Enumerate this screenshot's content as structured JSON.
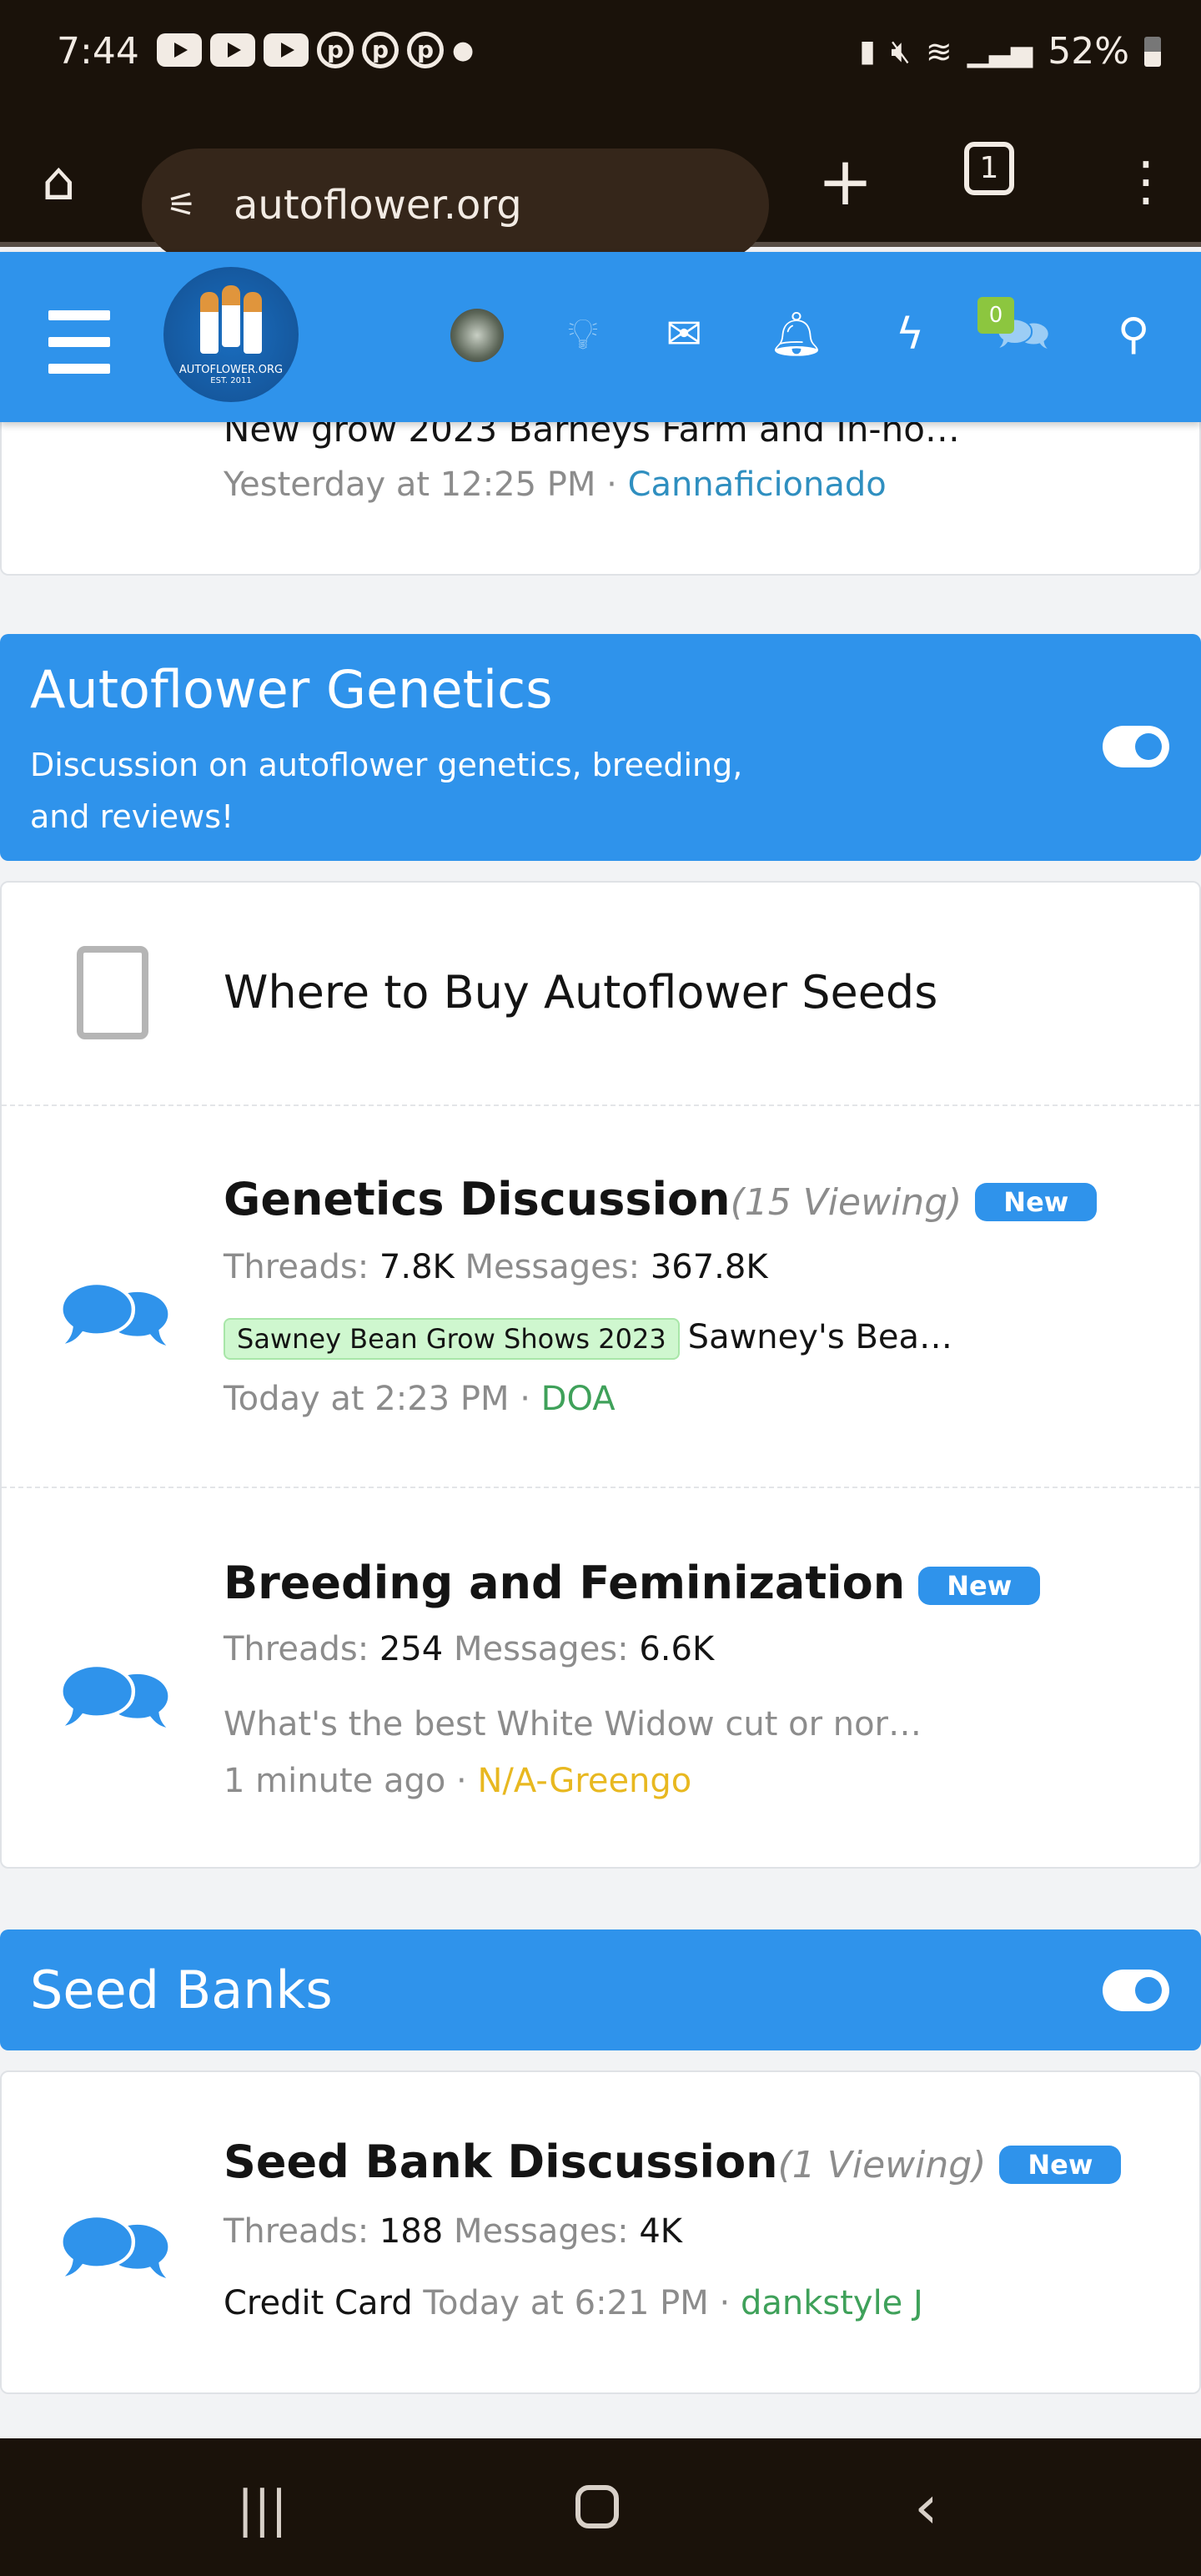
{
  "status_bar": {
    "time": "7:44",
    "battery": "52%",
    "notification_icons": [
      "youtube-icon",
      "youtube-icon",
      "youtube-icon",
      "pinterest-icon",
      "pinterest-icon",
      "pinterest-icon"
    ]
  },
  "browser": {
    "url": "autoflower.org",
    "tab_count": "1"
  },
  "header": {
    "logo_text": "AUTOFLOWER.ORG",
    "logo_sub": "EST. 2011",
    "conversations_badge": "0",
    "accent": "#2f93eb"
  },
  "prev_card": {
    "thread": "New grow 2023 Barneys Farm and In-ho…",
    "time": "Yesterday at 12:25 PM",
    "user": "Cannaficionado",
    "user_color": "#2f8fc0"
  },
  "categories": [
    {
      "title": "Autoflower Genetics",
      "description": "Discussion on autoflower genetics, breeding, and reviews!",
      "link_forum": {
        "title": "Where to Buy Autoflower Seeds"
      },
      "forums": [
        {
          "title": "Genetics Discussion",
          "viewing": "(15 Viewing)",
          "badge": "New",
          "threads_label": "Threads:",
          "threads": "7.8K",
          "messages_label": "Messages:",
          "messages": "367.8K",
          "prefix": "Sawney Bean Grow Shows 2023",
          "last_thread": "Sawney's Bea…",
          "time": "Today at 2:23 PM",
          "user": "DOA",
          "user_color": "#3fa15a"
        },
        {
          "title": "Breeding and Feminization",
          "viewing": "",
          "badge": "New",
          "threads_label": "Threads:",
          "threads": "254",
          "messages_label": "Messages:",
          "messages": "6.6K",
          "last_thread": "What's the best White Widow cut or nor…",
          "time": "1 minute ago",
          "user": "N/A-Greengo",
          "user_color": "#e8b820"
        }
      ]
    },
    {
      "title": "Seed Banks",
      "forums": [
        {
          "title": "Seed Bank Discussion",
          "viewing": "(1 Viewing)",
          "badge": "New",
          "threads_label": "Threads:",
          "threads": "188",
          "messages_label": "Messages:",
          "messages": "4K",
          "last_thread": "Credit Card",
          "time": "Today at 6:21 PM",
          "user": "dankstyle J",
          "user_color": "#3fa15a"
        }
      ]
    }
  ]
}
